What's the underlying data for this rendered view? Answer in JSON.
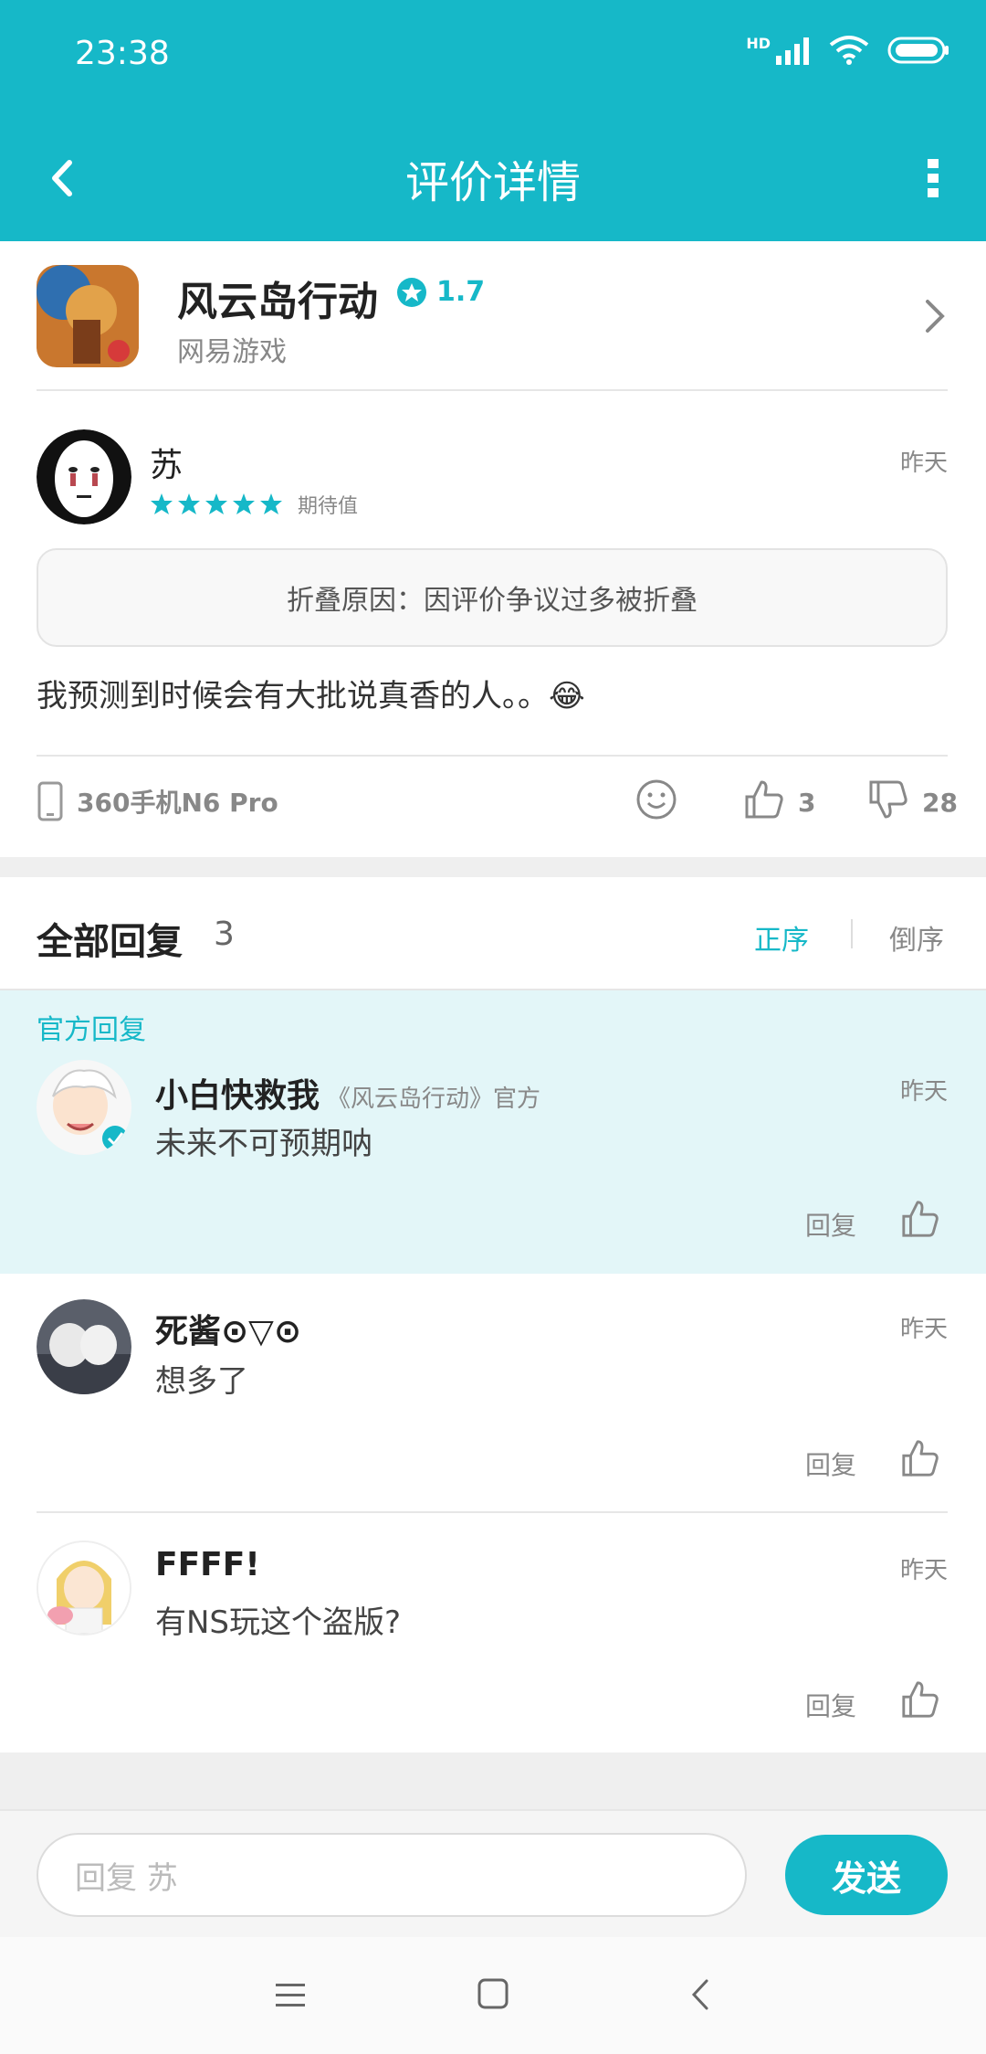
{
  "status_bar": {
    "time": "23:38",
    "network": "HD"
  },
  "app_bar": {
    "title": "评价详情"
  },
  "game": {
    "name": "风云岛行动",
    "rating": "1.7",
    "developer": "网易游戏"
  },
  "review": {
    "author": "苏",
    "stars": 5,
    "star_label": "期待值",
    "time": "昨天",
    "fold_reason": "折叠原因：因评价争议过多被折叠",
    "text": "我预测到时候会有大批说真香的人。。😂",
    "device": "360手机N6 Pro",
    "likes": "3",
    "dislikes": "28"
  },
  "replies_section": {
    "title": "全部回复",
    "count": "3",
    "sort_asc": "正序",
    "sort_desc": "倒序"
  },
  "replies": [
    {
      "official_label": "官方回复",
      "name": "小白快救我",
      "tag": "《风云岛行动》官方",
      "time": "昨天",
      "text": "未来不可预期呐",
      "reply_label": "回复"
    },
    {
      "name": "死酱⊙▽⊙",
      "time": "昨天",
      "text": "想多了",
      "reply_label": "回复"
    },
    {
      "name": "FFFF!",
      "time": "昨天",
      "text": "有NS玩这个盗版?",
      "reply_label": "回复"
    }
  ],
  "composer": {
    "placeholder": "回复 苏",
    "send_label": "发送"
  },
  "colors": {
    "accent": "#16b8c8",
    "official_bg": "#e3f6f8"
  }
}
